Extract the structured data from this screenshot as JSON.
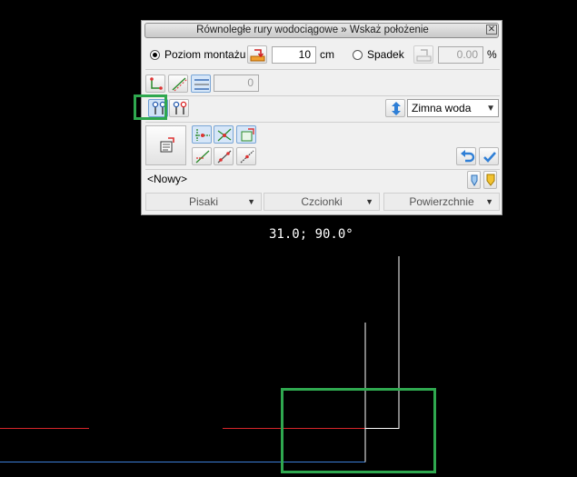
{
  "dialog": {
    "title": "Równoległe rury wodociągowe » Wskaż położenie",
    "close_symbol": "✕",
    "row1": {
      "radio_level_label": "Poziom montażu",
      "level_value": "10",
      "level_unit": "cm",
      "radio_slope_label": "Spadek",
      "slope_value": "0.00",
      "slope_unit": "%"
    },
    "row2": {
      "count_value": "0"
    },
    "row3": {
      "medium_select": "Zimna woda"
    },
    "name_field": "<Nowy>",
    "bottom_tabs": [
      "Pisaki",
      "Czcionki",
      "Powierzchnie"
    ]
  },
  "canvas": {
    "coordinate_readout": "31.0;  90.0°",
    "colors": {
      "background": "#000000",
      "pipe_red": "#d9262b",
      "pipe_blue": "#3d7fd8",
      "pipe_white": "#ffffff",
      "highlight": "#2fa84f"
    }
  },
  "icons": [
    "pipe-up-icon",
    "slope-line-icon",
    "parallel-lines-icon",
    "parallel-pipes-icon",
    "parallel-pipes-alt-icon",
    "sort-arrows-icon",
    "properties-icon",
    "snap-icons",
    "undo-icon",
    "check-icon",
    "pen-icon",
    "marker-icon"
  ]
}
